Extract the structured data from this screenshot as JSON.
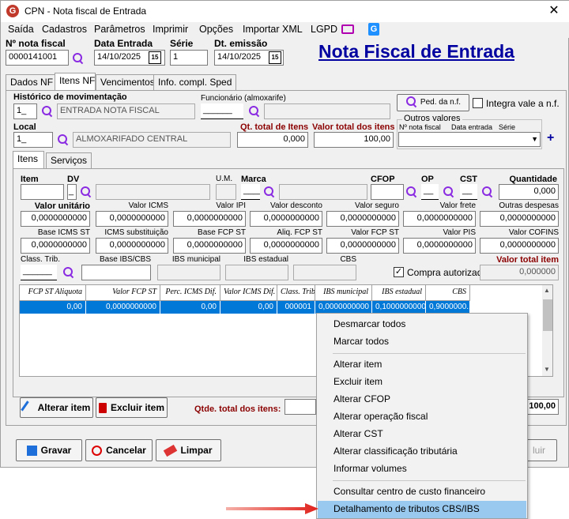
{
  "window": {
    "title": "CPN - Nota fiscal de Entrada",
    "close": "✕"
  },
  "menu": [
    "Saída",
    "Cadastros",
    "Parâmetros",
    "Imprimir",
    "Opções",
    "Importar XML",
    "LGPD"
  ],
  "header": {
    "nf_label": "Nº nota fiscal",
    "nf_value": "0000141001",
    "date_in_label": "Data Entrada",
    "date_in_value": "14/10/2025",
    "serie_label": "Série",
    "serie_value": "1",
    "emission_label": "Dt. emissão",
    "emission_value": "14/10/2025",
    "page_title": "Nota Fiscal de Entrada",
    "cal_icon": "15"
  },
  "tabs": [
    "Dados NF",
    "Itens NF",
    "Vencimentos",
    "Info. compl. Sped"
  ],
  "itens_nf": {
    "hist_label": "Histórico de movimentação",
    "hist_code": "1_",
    "hist_desc": "ENTRADA NOTA FISCAL",
    "func_label": "Funcionário (almoxarife)",
    "func_code": "______",
    "ped_button": "Ped. da n.f.",
    "integra_label": "Integra vale a n.f.",
    "local_label": "Local",
    "local_code": "1_",
    "local_desc": "ALMOXARIFADO CENTRAL",
    "qt_total_label": "Qt. total de Itens",
    "qt_total_value": "0,000",
    "valor_total_label": "Valor total dos itens",
    "valor_total_value": "100,00",
    "outros_label": "Outros valores",
    "outros_cols": [
      "Nº nota fiscal",
      "Data entrada",
      "Série"
    ],
    "plus": "+"
  },
  "subtabs": [
    "Itens",
    "Serviços"
  ],
  "item_fields": {
    "item_label": "Item",
    "dv_label": "DV",
    "dv_value": "_",
    "um_label": "U.M.",
    "marca_label": "Marca",
    "marca_value": "____",
    "cfop_label": "CFOP",
    "op_label": "OP",
    "op_value": "__",
    "cst_label": "CST",
    "cst_value": "__",
    "quantidade_label": "Quantidade",
    "quantidade_value": "0,000",
    "row1": [
      {
        "label": "Valor unitário",
        "value": "0,0000000000"
      },
      {
        "label": "Valor ICMS",
        "value": "0,0000000000"
      },
      {
        "label": "Valor IPI",
        "value": "0,0000000000"
      },
      {
        "label": "Valor desconto",
        "value": "0,0000000000"
      },
      {
        "label": "Valor seguro",
        "value": "0,0000000000"
      },
      {
        "label": "Valor frete",
        "value": "0,0000000000"
      },
      {
        "label": "Outras despesas",
        "value": "0,0000000000"
      }
    ],
    "row2": [
      {
        "label": "Base ICMS ST",
        "value": "0,0000000000"
      },
      {
        "label": "ICMS substituição",
        "value": "0,0000000000"
      },
      {
        "label": "Base FCP ST",
        "value": "0,0000000000"
      },
      {
        "label": "Aliq. FCP ST",
        "value": "0,0000000000"
      },
      {
        "label": "Valor FCP ST",
        "value": "0,0000000000"
      },
      {
        "label": "Valor PIS",
        "value": "0,0000000000"
      },
      {
        "label": "Valor COFINS",
        "value": "0,0000000000"
      }
    ],
    "class_trib_label": "Class. Trib.",
    "class_trib_value": "______",
    "base_ibs_label": "Base IBS/CBS",
    "ibs_mun_label": "IBS municipal",
    "ibs_est_label": "IBS estadual",
    "cbs_label": "CBS",
    "compra_label": "Compra autorizada",
    "compra_check": "✓",
    "valor_total_item_label": "Valor total item",
    "valor_total_item_value": "0,000000"
  },
  "grid": {
    "columns": [
      "FCP ST Aliquota",
      "Valor FCP ST",
      "Perc. ICMS Dif.",
      "Valor ICMS Dif.",
      "Class. Trib.",
      "IBS municipal",
      "IBS estadual",
      "CBS"
    ],
    "row": [
      "0,00",
      "0,0000000000",
      "0,00",
      "0,00",
      "000001",
      "0,0000000000",
      "0,1000000000",
      "0,9000000..."
    ],
    "scroll_up": "▲",
    "scroll_down": "▼"
  },
  "item_buttons": {
    "alterar": "Alterar item",
    "excluir": "Excluir item",
    "qtde_label": "Qtde. total dos itens:",
    "total_value": "100,00"
  },
  "footer": {
    "gravar": "Gravar",
    "cancelar": "Cancelar",
    "limpar": "Limpar",
    "incluir_partial": "luir"
  },
  "context_menu": [
    "Desmarcar todos",
    "Marcar todos",
    "Alterar item",
    "Excluir item",
    "Alterar CFOP",
    "Alterar operação fiscal",
    "Alterar CST",
    "Alterar classificação tributária",
    "Informar volumes",
    "Consultar centro de custo financeiro",
    "Detalhamento de tributos CBS/IBS"
  ],
  "colors": {
    "accent": "#0078d7",
    "title_blue": "#0000a0",
    "red_label": "#8b0000",
    "highlight": "#99c9ef",
    "arrow": "#e0201a"
  }
}
